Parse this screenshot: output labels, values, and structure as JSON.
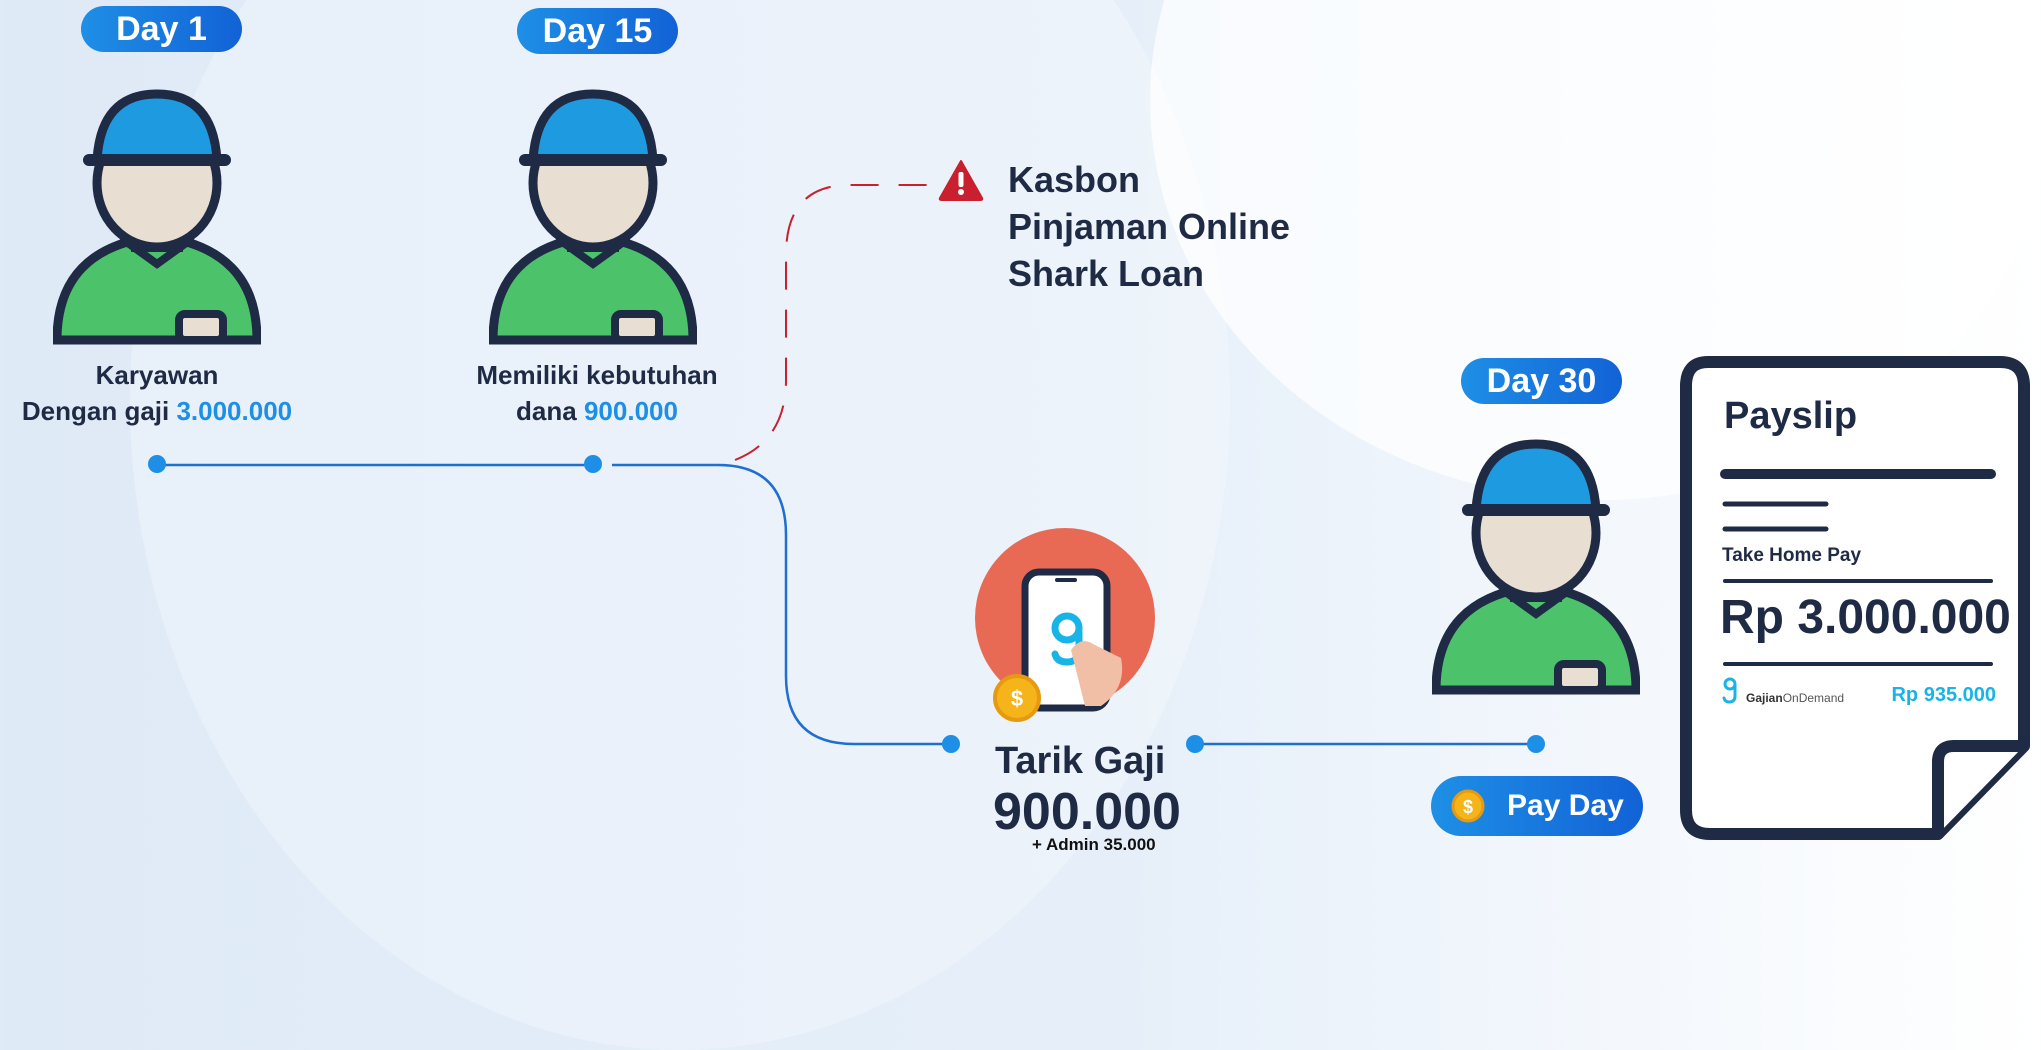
{
  "day_labels": [
    "Day 1",
    "Day 15",
    "Day 30"
  ],
  "steps": {
    "day1": {
      "line1": "Karyawan",
      "line2_prefix": "Dengan gaji ",
      "line2_value": "3.000.000"
    },
    "day15": {
      "line1": "Memiliki kebutuhan",
      "line2_prefix": "dana ",
      "line2_value": "900.000"
    }
  },
  "warning": {
    "icon": "warning-triangle-icon",
    "items": [
      "Kasbon",
      "Pinjaman Online",
      "Shark Loan"
    ]
  },
  "withdraw": {
    "icon": "phone-app-icon",
    "label": "Tarik Gaji",
    "amount": "900.000",
    "fee": "+ Admin 35.000"
  },
  "payday": {
    "icon": "coin-icon",
    "label": "Pay Day"
  },
  "payslip": {
    "title": "Payslip",
    "take_home_label": "Take Home Pay",
    "take_home_amount": "Rp 3.000.000",
    "brand_bold": "Gajian",
    "brand_rest": "OnDemand",
    "deduction": "Rp 935.000"
  },
  "colors": {
    "accent": "#1e8fe6",
    "dark": "#1f2a44",
    "warning": "#c8202f",
    "shirt": "#4cc26a",
    "cap": "#1e9be0",
    "circle": "#e86a55"
  }
}
